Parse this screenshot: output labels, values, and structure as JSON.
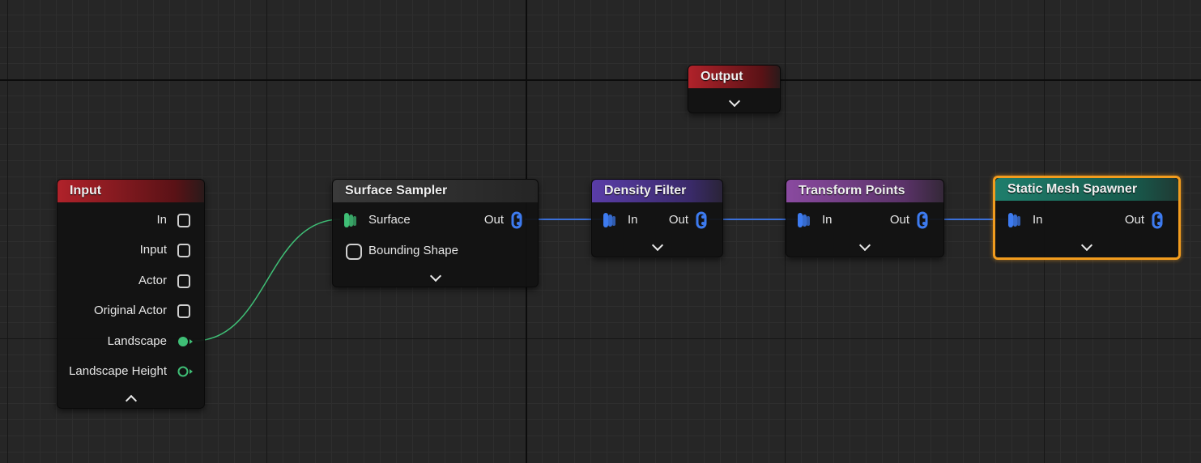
{
  "colors": {
    "input_header": "#b0222a",
    "output_header": "#b0222a",
    "sampler_header": "#333333",
    "density_header": "#5a3da8",
    "transform_header": "#8a4aa0",
    "spawner_header": "#1f7e6c",
    "spatial_pin": "#3d7bf0",
    "surface_pin": "#3fbf76",
    "selection": "#f29c1e",
    "wire_blue": "#3a6fd8",
    "wire_green": "#3fbf76"
  },
  "nodes": {
    "output": {
      "title": "Output"
    },
    "input": {
      "title": "Input",
      "pins": [
        "In",
        "Input",
        "Actor",
        "Original Actor",
        "Landscape",
        "Landscape Height"
      ]
    },
    "surface_sampler": {
      "title": "Surface Sampler",
      "in_pin": "Surface",
      "out_pin": "Out",
      "extra_pin": "Bounding Shape"
    },
    "density_filter": {
      "title": "Density Filter",
      "in_pin": "In",
      "out_pin": "Out"
    },
    "transform_points": {
      "title": "Transform Points",
      "in_pin": "In",
      "out_pin": "Out"
    },
    "static_mesh_spawner": {
      "title": "Static Mesh Spawner",
      "in_pin": "In",
      "out_pin": "Out",
      "selected": true
    }
  }
}
